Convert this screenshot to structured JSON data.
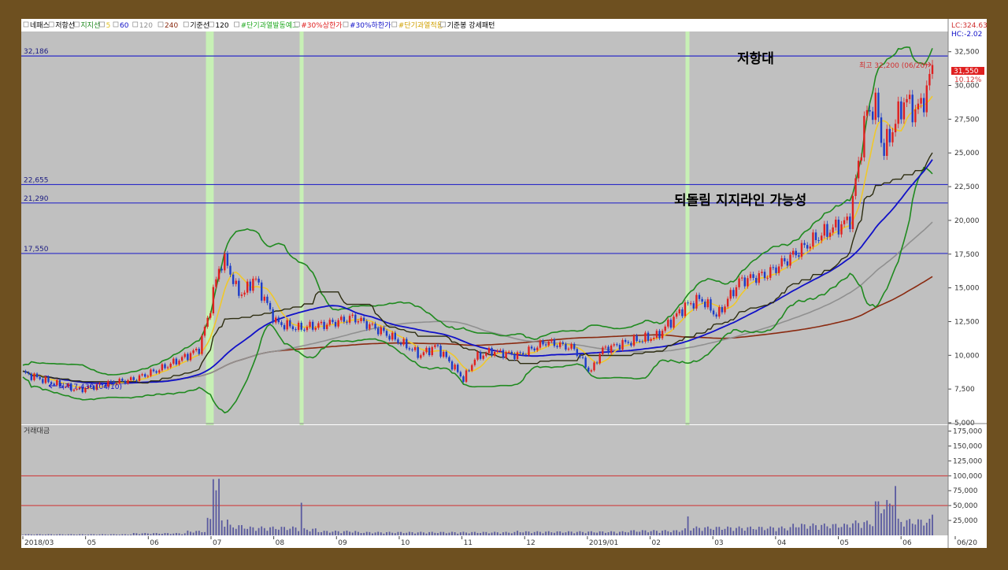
{
  "colors": {
    "frame": "#6e5020",
    "plot_bg": "#c0c0c0",
    "axis_bg": "#ffffff",
    "candle_up": "#e02020",
    "candle_down": "#1c3cc8",
    "support_line": "#2a2ac8",
    "highlight": "#c8f5b4",
    "bollinger": "#1f8a1f",
    "ma5": "#f0c82a",
    "ma60": "#1010c8",
    "ma120": "#909090",
    "ma240": "#8a2a10",
    "base_line": "#2c2c10",
    "volume_bar": "#5a5aa0",
    "volume_ref": "#d03030"
  },
  "legend": [
    {
      "label": "네패스",
      "color": "#000000"
    },
    {
      "label": "저항선",
      "color": "#000000"
    },
    {
      "label": "지지선",
      "color": "#1f8a1f"
    },
    {
      "label": "5",
      "color": "#e0c020"
    },
    {
      "label": "60",
      "color": "#1010c8"
    },
    {
      "label": "120",
      "color": "#909090"
    },
    {
      "label": "240",
      "color": "#8a2a10"
    },
    {
      "label": "기준선",
      "color": "#000000"
    },
    {
      "label": "120",
      "color": "#000000"
    },
    {
      "label": "#단기과열발동예고",
      "color": "#22aa22"
    },
    {
      "label": "#30%상한가",
      "color": "#e02020"
    },
    {
      "label": "#30%하한가",
      "color": "#1010c8"
    },
    {
      "label": "#단기과열적용",
      "color": "#d0a000"
    },
    {
      "label": "기준봉 강세패턴",
      "color": "#000000"
    }
  ],
  "top_right": {
    "lc": "LC:324.63",
    "hc": "HC:-2.02"
  },
  "price_box": {
    "price": "31,550",
    "change": "10.12%"
  },
  "annotations": {
    "resistance": "저항대",
    "support": "되돌림 지지라인 가능성",
    "high": "최고 32,200 (06/20)",
    "low": "최저 7,430 (04/10)"
  },
  "volume_title": "거래대금",
  "chart_data": [
    {
      "type": "candlestick",
      "title": "",
      "ylim": [
        5000,
        34000
      ],
      "yticks": [
        "5,000",
        "7,500",
        "10,000",
        "12,500",
        "15,000",
        "17,500",
        "20,000",
        "22,500",
        "25,000",
        "27,500",
        "30,000",
        "32,500"
      ],
      "horizontal_lines": [
        {
          "label": "32,186",
          "value": 32186
        },
        {
          "label": "22,655",
          "value": 22655
        },
        {
          "label": "21,290",
          "value": 21290
        },
        {
          "label": "17,550",
          "value": 17550
        }
      ],
      "x_ticks": [
        "2018/03",
        "05",
        "06",
        "07",
        "08",
        "09",
        "10",
        "11",
        "12",
        "2019/01",
        "02",
        "03",
        "04",
        "05",
        "06",
        "06/20"
      ],
      "highlight_months": [
        3.35,
        3.42,
        5.05,
        12.05
      ],
      "price_anchors": [
        [
          0,
          8700
        ],
        [
          0.5,
          8000
        ],
        [
          1,
          7430
        ],
        [
          1.5,
          7900
        ],
        [
          2,
          8200
        ],
        [
          2.5,
          9000
        ],
        [
          3,
          10000
        ],
        [
          3.2,
          10500
        ],
        [
          3.4,
          13500
        ],
        [
          3.55,
          16500
        ],
        [
          3.7,
          17000
        ],
        [
          3.85,
          15000
        ],
        [
          4,
          14500
        ],
        [
          4.2,
          15800
        ],
        [
          4.4,
          14000
        ],
        [
          4.6,
          12400
        ],
        [
          5,
          12000
        ],
        [
          5.5,
          12300
        ],
        [
          6,
          12800
        ],
        [
          6.5,
          11800
        ],
        [
          7,
          10600
        ],
        [
          7.2,
          10000
        ],
        [
          7.5,
          10700
        ],
        [
          8,
          8200
        ],
        [
          8.2,
          9800
        ],
        [
          8.5,
          10300
        ],
        [
          9,
          10000
        ],
        [
          9.5,
          11000
        ],
        [
          10,
          10500
        ],
        [
          10.3,
          8700
        ],
        [
          10.5,
          10400
        ],
        [
          11,
          11000
        ],
        [
          11.5,
          11400
        ],
        [
          12,
          13600
        ],
        [
          12.3,
          14200
        ],
        [
          12.6,
          12900
        ],
        [
          13,
          15500
        ],
        [
          13.5,
          16000
        ],
        [
          14,
          17500
        ],
        [
          14.5,
          19000
        ],
        [
          15,
          20000
        ],
        [
          15.3,
          28000
        ],
        [
          15.5,
          28500
        ],
        [
          15.6,
          25000
        ],
        [
          15.8,
          27000
        ],
        [
          16,
          29000
        ],
        [
          16.2,
          28000
        ],
        [
          16.4,
          29500
        ],
        [
          16.5,
          31550
        ]
      ],
      "volume_anchors": [
        [
          0,
          2000
        ],
        [
          2,
          4000
        ],
        [
          3,
          8000
        ],
        [
          3.35,
          30000
        ],
        [
          3.45,
          175000
        ],
        [
          3.55,
          95000
        ],
        [
          3.7,
          30000
        ],
        [
          4,
          18000
        ],
        [
          5,
          15000
        ],
        [
          5.05,
          65000
        ],
        [
          5.3,
          12000
        ],
        [
          6,
          8000
        ],
        [
          7,
          6000
        ],
        [
          8,
          6000
        ],
        [
          9,
          8000
        ],
        [
          10,
          7000
        ],
        [
          11,
          9000
        ],
        [
          12,
          12000
        ],
        [
          12.05,
          35000
        ],
        [
          13,
          15000
        ],
        [
          14,
          20000
        ],
        [
          15,
          25000
        ],
        [
          15.5,
          60000
        ],
        [
          15.8,
          100000
        ],
        [
          16,
          28000
        ],
        [
          16.5,
          40000
        ]
      ],
      "volume_yticks": [
        "25,000",
        "50,000",
        "75,000",
        "100,000",
        "125,000",
        "150,000",
        "175,000"
      ],
      "volume_ylim": [
        0,
        185000
      ],
      "volume_ref_lines": [
        50000,
        100000
      ]
    }
  ]
}
